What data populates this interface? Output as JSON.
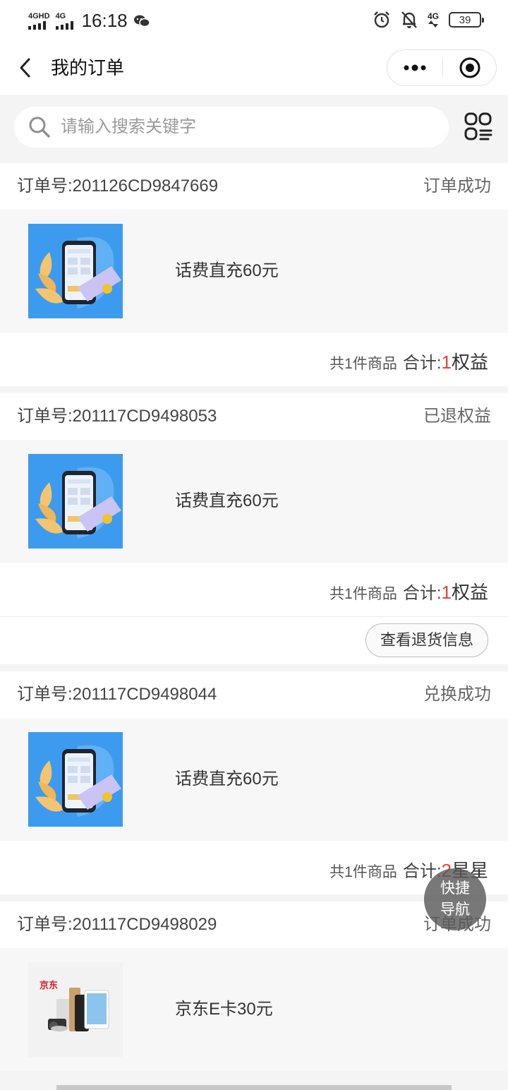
{
  "status_bar": {
    "net1": "4GHD",
    "net2": "4G",
    "time": "16:18",
    "net3": "4G",
    "battery": "39"
  },
  "nav": {
    "title": "我的订单"
  },
  "search": {
    "placeholder": "请输入搜索关键字",
    "value": ""
  },
  "orders": [
    {
      "id_label": "订单号:201126CD9847669",
      "status": "订单成功",
      "product": "话费直充60元",
      "count_text": "共1件商品",
      "total_label": "合计:",
      "total_value": "1",
      "total_unit": "权益"
    },
    {
      "id_label": "订单号:201117CD9498053",
      "status": "已退权益",
      "product": "话费直充60元",
      "count_text": "共1件商品",
      "total_label": "合计:",
      "total_value": "1",
      "total_unit": "权益",
      "action": "查看退货信息"
    },
    {
      "id_label": "订单号:201117CD9498044",
      "status": "兑换成功",
      "product": "话费直充60元",
      "count_text": "共1件商品",
      "total_label": "合计:",
      "total_value": "2",
      "total_unit": "星星"
    },
    {
      "id_label": "订单号:201117CD9498029",
      "status": "订单成功",
      "product": "京东E卡30元",
      "brand_logo": "京东"
    }
  ],
  "fab": {
    "line1": "快捷",
    "line2": "导航"
  },
  "colors": {
    "accent": "#e64340",
    "phone_card_bg": "#3d9bef"
  }
}
